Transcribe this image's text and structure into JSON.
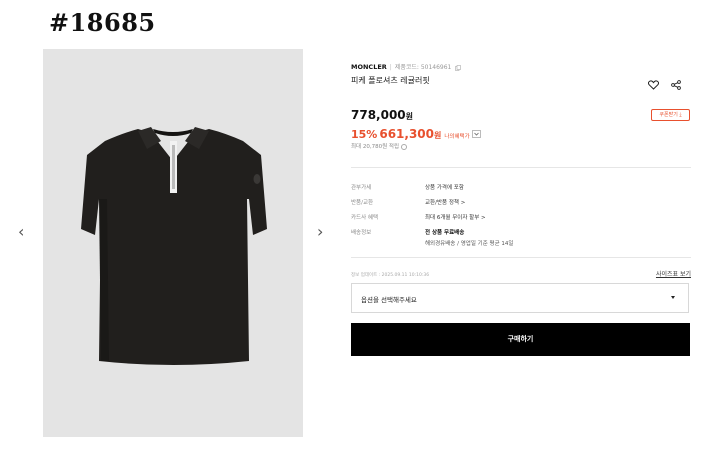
{
  "post_id": "#18685",
  "gallery": {
    "prev_arrow": "‹",
    "next_arrow": "›"
  },
  "product": {
    "brand": "MONCLER",
    "code_label": "제품코드: 50146961",
    "name": "피케 폴로셔츠 레귤러핏",
    "price": "778,000",
    "price_unit": "원",
    "sale_rate": "15%",
    "sale_price": "661,300",
    "sale_unit": "원",
    "my_price_label": "나의혜택가",
    "points": "최대 20,780원 적립",
    "coupon_label": "쿠폰받기"
  },
  "specs": [
    {
      "key": "관부가세",
      "value": "상품 가격에 포함"
    },
    {
      "key": "반품/교환",
      "value": "교환/반품 정책 >"
    },
    {
      "key": "카드사 혜택",
      "value": "최대 6개월 무이자 할부 >"
    },
    {
      "key": "배송정보",
      "value": "전 상품 무료배송",
      "sub": "해외경유배송 / 영업일 기준 평균 14일"
    }
  ],
  "updated_label": "정보 업데이트 : 2025.09.11 10:10:36",
  "size_guide_label": "사이즈표 보기",
  "option_placeholder": "옵션을 선택해주세요",
  "buy_label": "구매하기",
  "colors": {
    "accent": "#e8502e",
    "buy_button": "#000000",
    "gallery_bg": "#e4e4e4",
    "shirt": "#211f1d"
  }
}
